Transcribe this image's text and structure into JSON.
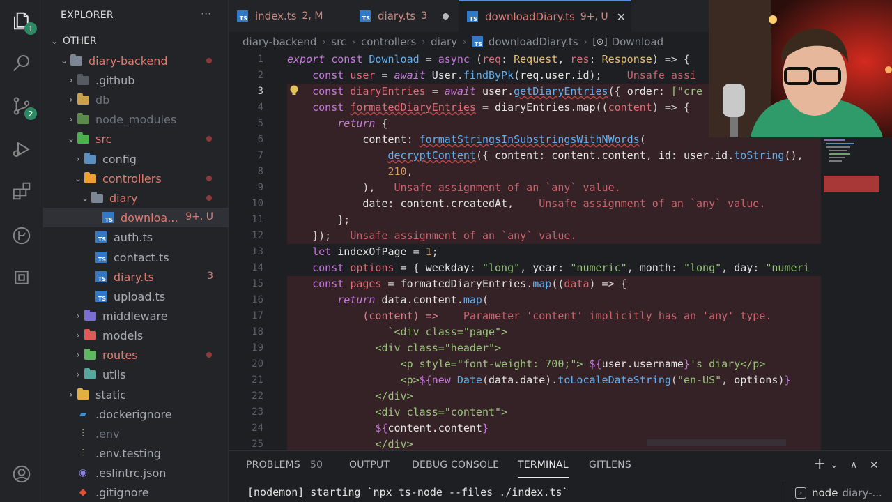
{
  "sidebar": {
    "title": "EXPLORER",
    "more": "···",
    "items": [
      {
        "label": "OTHER",
        "badge": ""
      },
      {
        "label": "diary-backend",
        "badge": ""
      },
      {
        "label": ".github",
        "badge": ""
      },
      {
        "label": "db",
        "badge": ""
      },
      {
        "label": "node_modules",
        "badge": ""
      },
      {
        "label": "src",
        "badge": ""
      },
      {
        "label": "config",
        "badge": ""
      },
      {
        "label": "controllers",
        "badge": ""
      },
      {
        "label": "diary",
        "badge": ""
      },
      {
        "label": "downloa...",
        "badge": "9+, U"
      },
      {
        "label": "auth.ts",
        "badge": ""
      },
      {
        "label": "contact.ts",
        "badge": ""
      },
      {
        "label": "diary.ts",
        "badge": "3"
      },
      {
        "label": "upload.ts",
        "badge": ""
      },
      {
        "label": "middleware",
        "badge": ""
      },
      {
        "label": "models",
        "badge": ""
      },
      {
        "label": "routes",
        "badge": ""
      },
      {
        "label": "utils",
        "badge": ""
      },
      {
        "label": "static",
        "badge": ""
      },
      {
        "label": ".dockerignore",
        "badge": ""
      },
      {
        "label": ".env",
        "badge": ""
      },
      {
        "label": ".env.testing",
        "badge": ""
      },
      {
        "label": ".eslintrc.json",
        "badge": ""
      },
      {
        "label": ".gitignore",
        "badge": ""
      }
    ]
  },
  "activity": {
    "explorer_badge": "1",
    "scm_badge": "2"
  },
  "tabs": [
    {
      "label": "index.ts",
      "info": "2, M"
    },
    {
      "label": "diary.ts",
      "info": "3"
    },
    {
      "label": "downloadDiary.ts",
      "info": "9+, U",
      "close": "✕"
    }
  ],
  "breadcrumb": [
    "diary-backend",
    "src",
    "controllers",
    "diary",
    "downloadDiary.ts",
    "Download"
  ],
  "editor": {
    "line_numbers": [
      "1",
      "2",
      "3",
      "4",
      "5",
      "6",
      "7",
      "8",
      "9",
      "10",
      "11",
      "12",
      "13",
      "14",
      "15",
      "16",
      "17",
      "18",
      "19",
      "20",
      "21",
      "22",
      "23",
      "24",
      "25"
    ],
    "tokens": {
      "export": "export",
      "const": "const",
      "async": "async",
      "await": "await",
      "return": "return",
      "let": "let",
      "new": "new",
      "Download": "Download",
      "req": "req",
      "Request": "Request",
      "res": "res",
      "Response": "Response",
      "user": "user",
      "User": "User",
      "findByPk": "findByPk",
      "req_user_id": "req.user.id",
      "diaryEntries": "diaryEntries",
      "getDiaryEntries": "getDiaryEntries",
      "order": "order",
      "cre": "[\"cre",
      "formatedDiaryEntries": "formatedDiaryEntries",
      "map": "map",
      "content": "content",
      "formatStrings": "formatStringsInSubstringsWithNWords",
      "decryptContent": "decryptContent",
      "content_content": "content.content",
      "id": "id",
      "user_id": "user.id",
      "toString": "toString",
      "n210": "210",
      "n1": "1",
      "date": "date",
      "content_createdAt": "content.createdAt",
      "indexOfPage": "indexOfPage",
      "options": "options",
      "weekday": "weekday",
      "long": "\"long\"",
      "year": "year",
      "numeric": "\"numeric\"",
      "month": "month",
      "day": "day",
      "numeri": "\"numeri",
      "pages": "pages",
      "data": "data",
      "data_content": "data.content",
      "Date": "Date",
      "data_date": "data.date",
      "toLocaleDateString": "toLocaleDateString",
      "enUS": "\"en-US\"",
      "html18": "`<div class=\"page\">",
      "html19": "<div class=\"header\">",
      "html20a": "<p style=\"font-weight: 700;\"> ",
      "user_username": "user.username",
      "html20b": "'s diary</p>",
      "html21a": "<p>",
      "html21b": "</p>",
      "html22": "</div>",
      "html23": "<div class=\"content\">",
      "html25": "</div>"
    },
    "diagnostics": {
      "line2": "Unsafe assi",
      "line9": "Unsafe assignment of an `any` value.",
      "line10": "Unsafe assignment of an `any` value.",
      "line12": "Unsafe assignment of an `any` value.",
      "line17": "Parameter 'content' implicitly has an 'any' type."
    }
  },
  "panel": {
    "tabs": [
      "PROBLEMS",
      "OUTPUT",
      "DEBUG CONSOLE",
      "TERMINAL",
      "GITLENS"
    ],
    "problems_count": "50",
    "terminal_line": "[nodemon] starting `npx ts-node --files ./index.ts`",
    "terminal_name": "node",
    "terminal_sub": "diary-...",
    "add": "+",
    "chevron": "⌄",
    "maximize": "∧",
    "close": "✕"
  },
  "colors": {
    "ts_blue": "#3178c6",
    "folder_src_green": "#4caf50",
    "folder_controllers_orange": "#f0a030",
    "error_red": "#e07a6e",
    "accent_blue": "#5b8be0"
  }
}
